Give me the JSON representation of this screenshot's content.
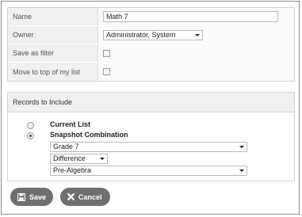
{
  "properties": {
    "name_label": "Name",
    "name_value": "Math 7",
    "owner_label": "Owner",
    "owner_value": "Administrator, System",
    "save_filter_label": "Save as filter",
    "move_top_label": "Move to top of my list"
  },
  "records": {
    "header": "Records to Include",
    "current_list_label": "Current List",
    "snapshot_label": "Snapshot Combination",
    "selected_option": "snapshot",
    "snapshot_1": "Grade 7",
    "operator": "Difference",
    "snapshot_2": "Pre-Algebra"
  },
  "buttons": {
    "save_label": "Save",
    "cancel_label": "Cancel"
  },
  "icons": {
    "save": "floppy-disk-icon",
    "cancel": "x-icon"
  },
  "colors": {
    "button_bg": "#6f6f6f",
    "label_bg": "#f0f0f0",
    "radio_selected": "#2a4e7a"
  }
}
